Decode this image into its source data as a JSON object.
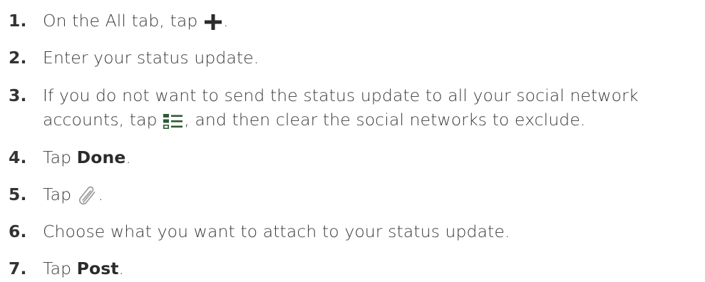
{
  "steps": [
    {
      "num": "1.",
      "before": "On the All tab, tap ",
      "icon": "plus-icon",
      "after": "."
    },
    {
      "num": "2.",
      "text": "Enter your status update."
    },
    {
      "num": "3.",
      "line1": "If you do not want to send the status update to all your social network",
      "line2_before": "accounts, tap ",
      "icon": "account-filter-icon",
      "line2_after": ", and then clear the social networks to exclude."
    },
    {
      "num": "4.",
      "before": "Tap ",
      "bold": "Done",
      "after": "."
    },
    {
      "num": "5.",
      "before": "Tap ",
      "icon": "paperclip-icon",
      "after": "."
    },
    {
      "num": "6.",
      "text": "Choose what you want to attach to your status update."
    },
    {
      "num": "7.",
      "before": "Tap ",
      "bold": "Post",
      "after": "."
    }
  ],
  "colors": {
    "text": "#3a3a3a",
    "icon_green": "#2e5a34",
    "icon_gray": "#9a9a9a"
  }
}
